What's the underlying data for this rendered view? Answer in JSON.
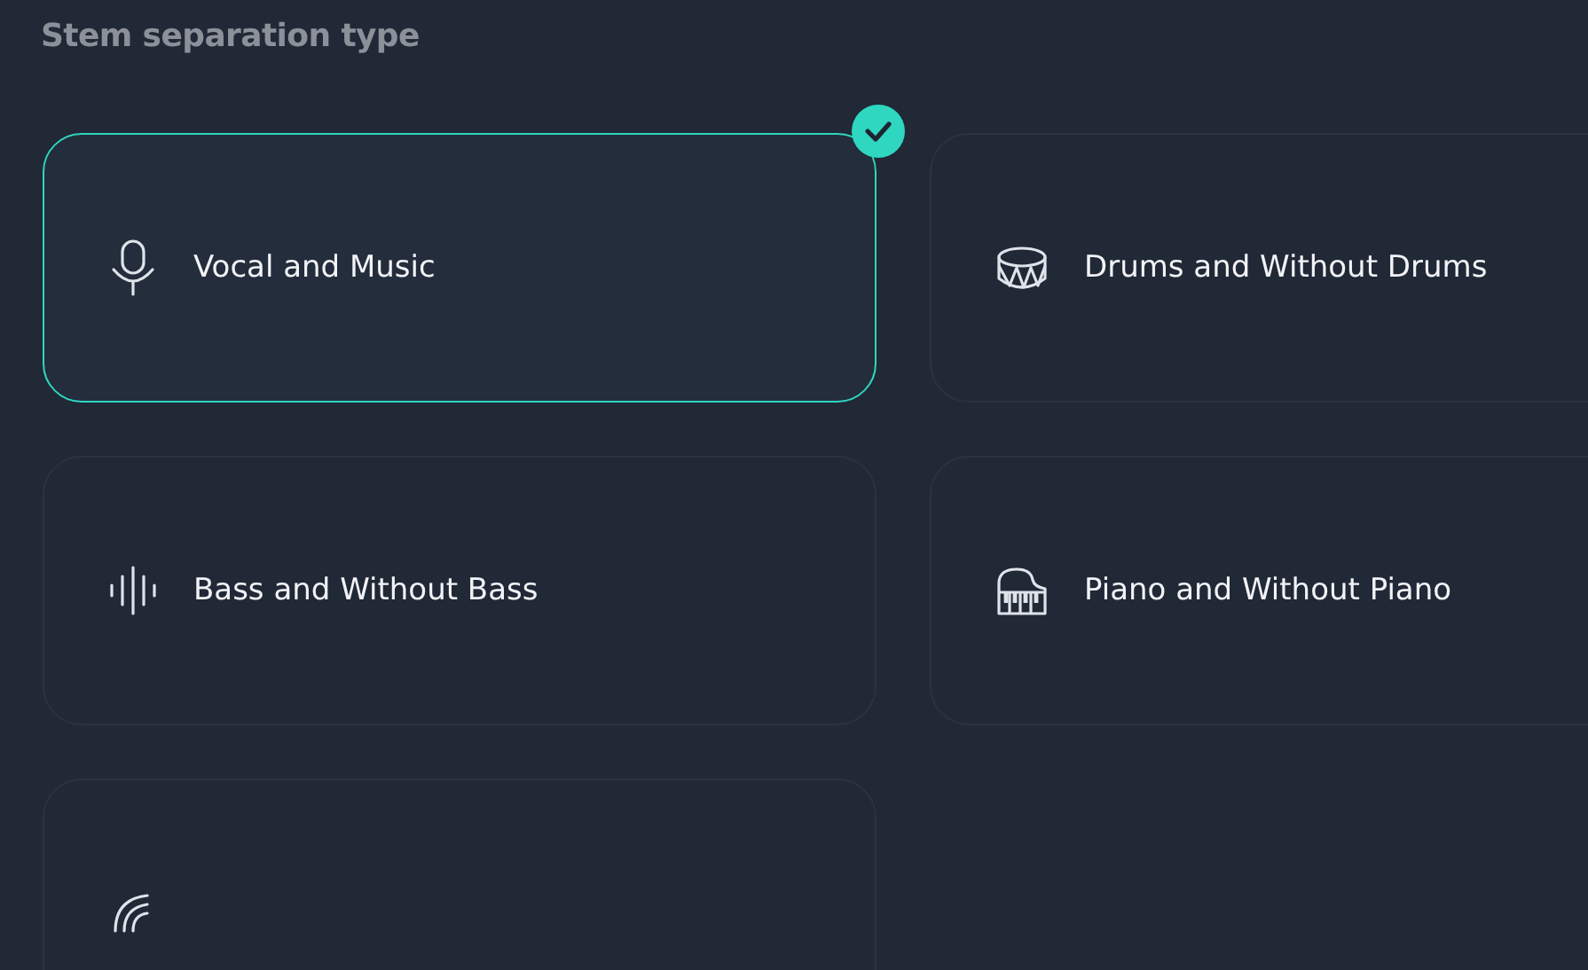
{
  "section_title": "Stem separation type",
  "options": [
    {
      "kind": "microphone",
      "label": "Vocal and Music",
      "selected": true
    },
    {
      "kind": "drum",
      "label": "Drums and Without Drums",
      "selected": false
    },
    {
      "kind": "bass",
      "label": "Bass and Without Bass",
      "selected": false
    },
    {
      "kind": "piano",
      "label": "Piano and Without Piano",
      "selected": false
    },
    {
      "kind": "noise",
      "selected": false
    }
  ]
}
